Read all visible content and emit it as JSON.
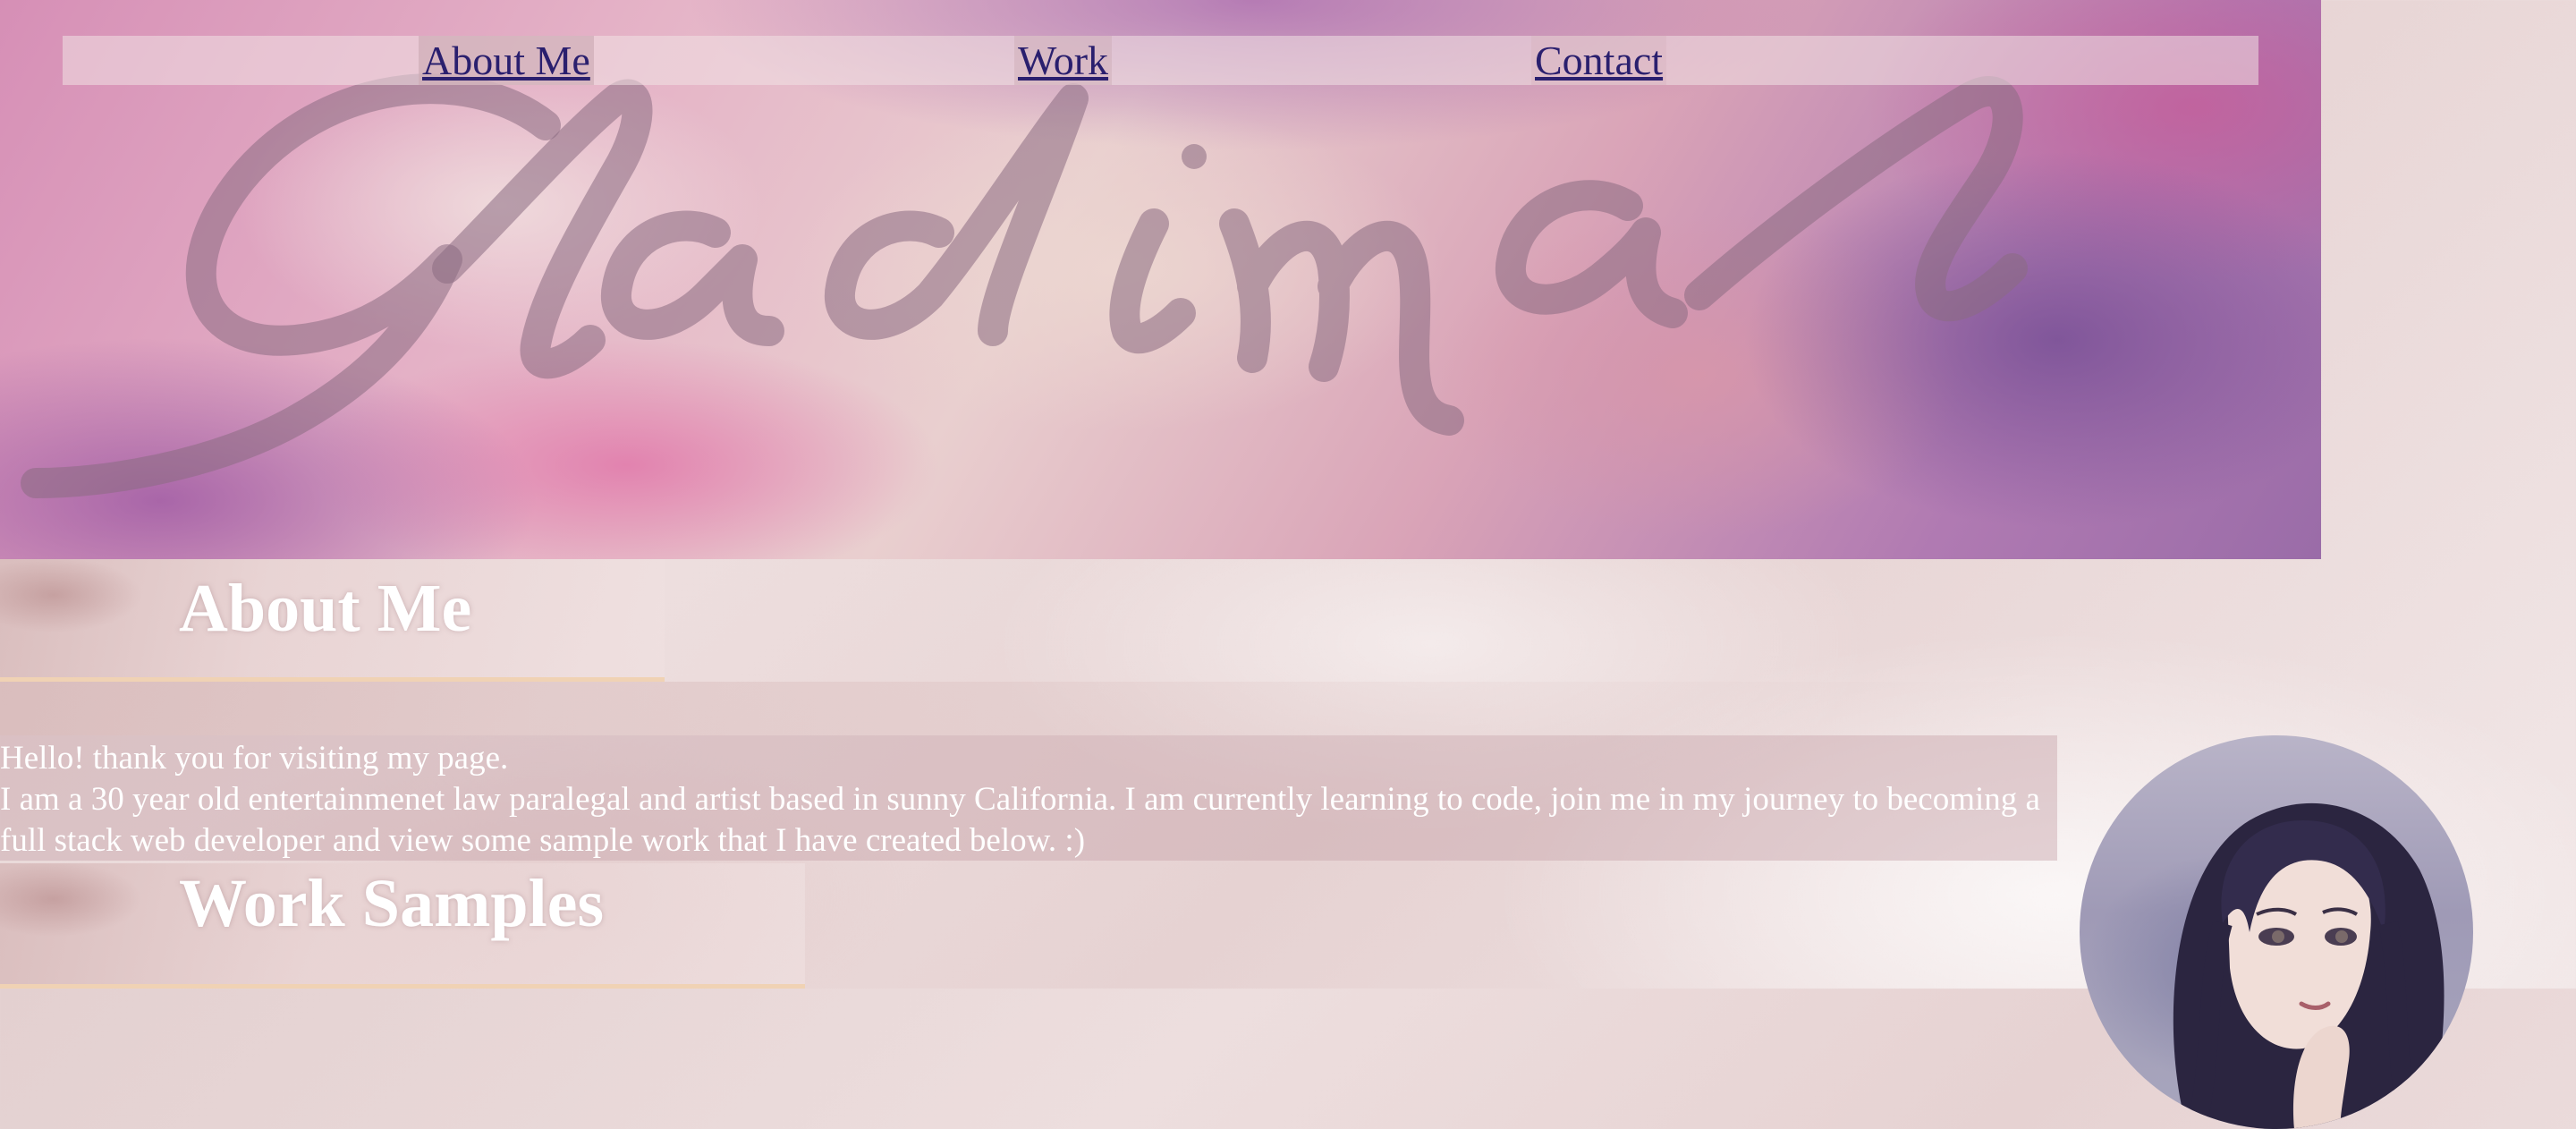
{
  "header": {
    "logo_text": "Gladimal",
    "nav": [
      {
        "label": "About Me"
      },
      {
        "label": "Work"
      },
      {
        "label": "Contact"
      }
    ]
  },
  "about": {
    "heading": "About Me",
    "greeting": "Hello! thank you for visiting my page.",
    "bio": "I am a 30 year old entertainmenet law paralegal and artist based in sunny California. I am currently learning to code, join me in my journey to becoming a full stack web developer and view some sample work that I have created below. :)"
  },
  "work": {
    "heading": "Work Samples"
  },
  "colors": {
    "link": "#2a1f6e",
    "heading_text": "#ffffff",
    "heading_underline": "#f0d2b4"
  }
}
